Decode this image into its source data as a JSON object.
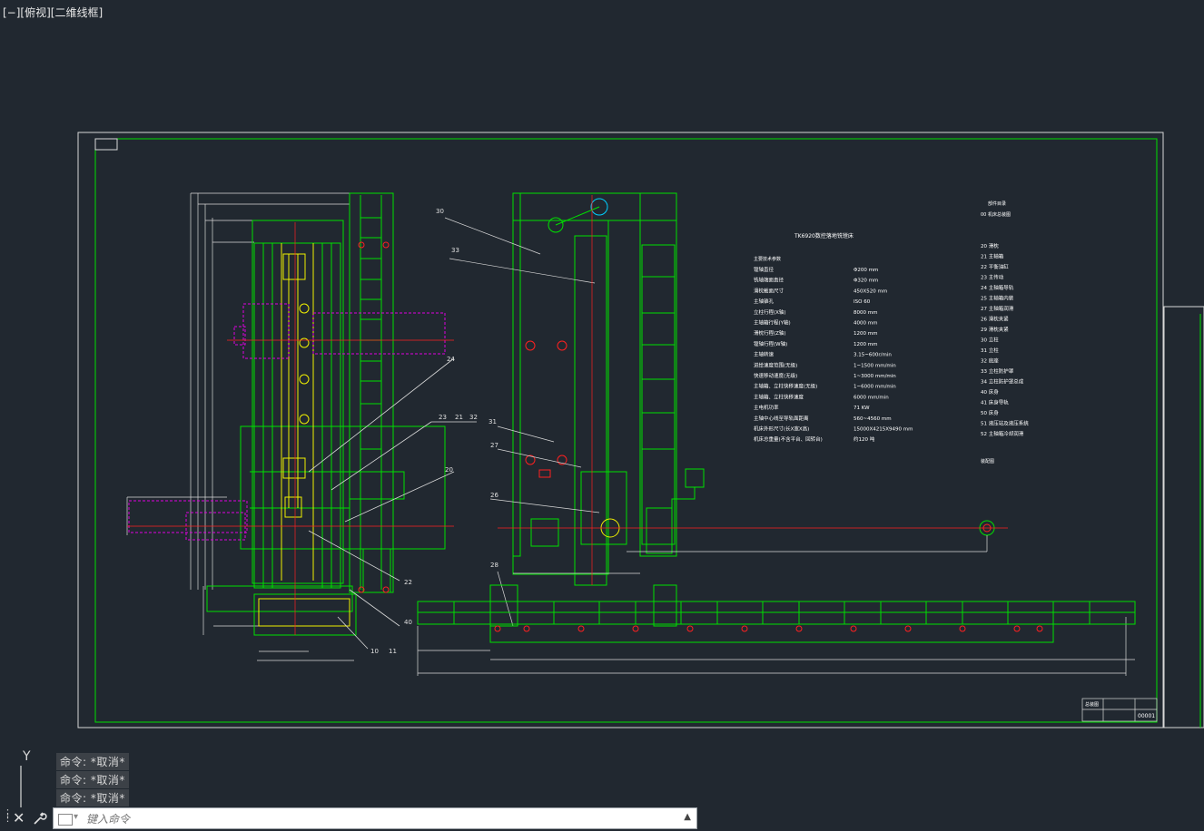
{
  "viewport": {
    "label": "[−][俯视][二维线框]"
  },
  "drawing": {
    "machine_title": "TK6920数控落地铣镗床",
    "callouts": [
      "30",
      "33",
      "24",
      "23",
      "21",
      "32",
      "31",
      "20",
      "27",
      "26",
      "22",
      "28",
      "40",
      "10",
      "11"
    ],
    "spec_section_title": "主要技术参数",
    "specs": [
      {
        "label": "镗轴直径",
        "value": "Φ200 mm"
      },
      {
        "label": "铣轴端面直径",
        "value": "Φ320 mm"
      },
      {
        "label": "滑枕截面尺寸",
        "value": "450X520 mm"
      },
      {
        "label": "主轴锥孔",
        "value": "ISO 60"
      },
      {
        "label": "立柱行程(X轴)",
        "value": "8000 mm"
      },
      {
        "label": "主轴箱行程(Y轴)",
        "value": "4000 mm"
      },
      {
        "label": "滑枕行程(Z轴)",
        "value": "1200 mm"
      },
      {
        "label": "镗轴行程(W轴)",
        "value": "1200 mm"
      },
      {
        "label": "主轴转速",
        "value": "3.15~600r/min"
      },
      {
        "label": "进给速度范围(无级)",
        "value": "1~1500 mm/min"
      },
      {
        "label": "快速移动速度(无级)",
        "value": "1~3000 mm/min"
      },
      {
        "label": "主轴箱、立柱快移速度(无级)",
        "value": "1~6000 mm/min"
      },
      {
        "label": "主轴箱、立柱快移速度",
        "value": "6000 mm/min"
      },
      {
        "label": "主电机功率",
        "value": "71 KW"
      },
      {
        "label": "主轴中心线至导轨面距离",
        "value": "560~4560 mm"
      },
      {
        "label": "机床外形尺寸(长X宽X高)",
        "value": "15000X4215X9490 mm"
      },
      {
        "label": "机床总重量(不含平台、回转台)",
        "value": "约120 吨"
      }
    ],
    "parts_header": [
      "部件目录",
      "00 机床总装图"
    ],
    "parts": [
      "20 滑枕",
      "21 主轴箱",
      "22 平衡油缸",
      "23 主传动",
      "24 主轴箱导轨",
      "25 主轴箱内装",
      "27 主轴箱润滑",
      "26 滑枕夹紧",
      "29 滑枕夹紧",
      "30 立柱",
      "31 立柱",
      "32 底座",
      "33 立柱防护罩",
      "34 立柱防护罩总成",
      "40 床身",
      "41 床身导轨",
      "50 床身",
      "51 液压站及液压系统",
      "52 主轴箱冷却润滑"
    ],
    "parts_footer": "装配图",
    "title_block": {
      "name": "总装图",
      "number": "00001"
    }
  },
  "command_line": {
    "history": [
      "命令: *取消*",
      "命令: *取消*",
      "命令: *取消*"
    ],
    "placeholder": "键入命令"
  },
  "ucs": {
    "y_label": "Y"
  },
  "colors": {
    "background": "#212830",
    "frame": "#d8d8d8",
    "green": "#00e000",
    "yellow": "#f0f000",
    "magenta": "#e000e0",
    "red": "#ff2020",
    "cyan": "#00d0ff"
  }
}
